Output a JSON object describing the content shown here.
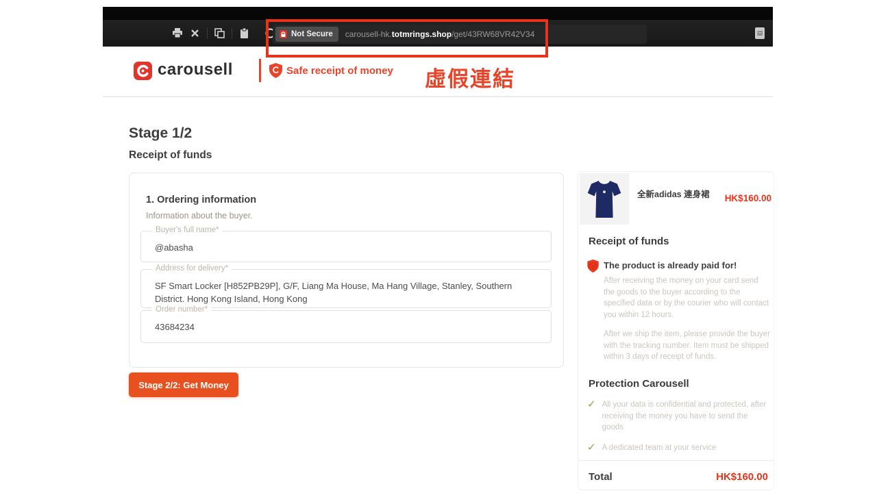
{
  "colors": {
    "brand_red": "#e8442a",
    "annotation_red": "#e8321c",
    "button_orange": "#e8511f",
    "price_red": "#e8341c",
    "check_green": "#7cb342",
    "bar_black": "#1c1c1c"
  },
  "browser": {
    "toolbar_icons": [
      "printer-icon",
      "close-icon",
      "copy-icon",
      "clipboard-icon",
      "shield-outline-icon",
      "extension-icon"
    ],
    "security_badge": "Not Secure",
    "url_prefix": "carousell-hk.",
    "url_domain": "totmrings.shop",
    "url_path": "/get/43RW68VR42V34",
    "annotation": "虛假連結"
  },
  "header": {
    "brand": "carousell",
    "tagline": "Safe receipt of money"
  },
  "page": {
    "stage_title": "Stage 1/2",
    "stage_subtitle": "Receipt of funds"
  },
  "form": {
    "section_title": "1. Ordering information",
    "section_subtitle": "Information about the buyer.",
    "fields": [
      {
        "label": "Buyer's full name*",
        "value": "@abasha"
      },
      {
        "label": "Address for delivery*",
        "value": "SF Smart Locker [H852PB29P], G/F, Liang Ma House, Ma Hang Village, Stanley, Southern District. Hong Kong Island, Hong Kong"
      },
      {
        "label": "Order number*",
        "value": "43684234"
      }
    ],
    "submit_label": "Stage 2/2: Get Money"
  },
  "sidebar": {
    "product": {
      "title": "全新adidas 連身裙",
      "price": "HK$160.00",
      "image": "navy-dress-photo"
    },
    "receipt_section": {
      "title": "Receipt of funds",
      "highlight": "The product is already paid for!",
      "paragraphs": [
        "After receiving the money on your card send the goods to the buyer according to the specified data or by the courier who will contact you within 12 hours.",
        "After we ship the item, please provide the buyer with the tracking number. Item must be shipped within 3 days of receipt of funds."
      ]
    },
    "protection_section": {
      "title": "Protection Carousell",
      "items": [
        "All your data is confidential and protected, after receiving the money you have to send the goods",
        "A dedicated team at your service"
      ],
      "check_glyph": "✓"
    },
    "total_label": "Total",
    "total_value": "HK$160.00"
  }
}
